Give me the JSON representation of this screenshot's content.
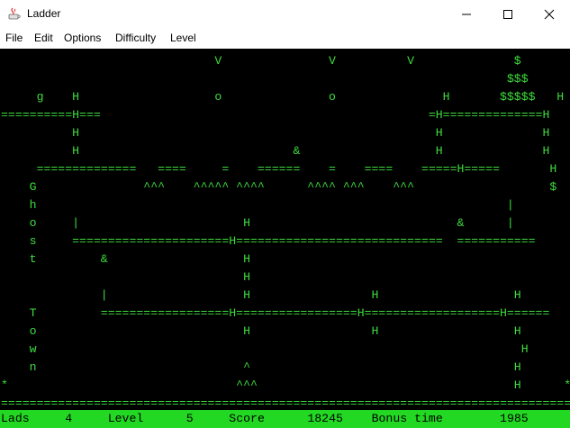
{
  "window": {
    "title": "Ladder",
    "minimize_icon": "minimize-icon",
    "maximize_icon": "maximize-icon",
    "close_icon": "close-icon"
  },
  "menu": {
    "items": [
      {
        "label": "File"
      },
      {
        "label": "Edit"
      },
      {
        "label": "Options"
      },
      {
        "label": "Difficulty"
      },
      {
        "label": "Level"
      }
    ]
  },
  "game": {
    "rows": [
      "                              V               V          V              $",
      "                                                                       $$$",
      "     g    H                   o               o               H       $$$$$   H",
      "==========H===                                              =H==============H",
      "          H                                                  H              H",
      "          H                              &                   H              H",
      "     ==============   ====     =    ======    =    ====    =====H=====       H",
      "    G               ^^^    ^^^^^ ^^^^      ^^^^ ^^^    ^^^                   $",
      "    h                                                                  |",
      "    o     |                       H                             &      |",
      "    s     ======================H=============================  ===========",
      "    t         &                   H",
      "                                  H",
      "              |                   H                 H                   H",
      "    T         ==================H=================H===================H======",
      "    o                             H                 H                   H",
      "    w                                                                    H",
      "    n                             ^                                     H",
      "*                                ^^^                                    H      *",
      "================================================================================"
    ]
  },
  "status": {
    "lads_label": "Lads",
    "lads_value": "4",
    "level_label": "Level",
    "level_value": "5",
    "score_label": "Score",
    "score_value": "18245",
    "bonus_label": "Bonus time",
    "bonus_value": "1985"
  }
}
